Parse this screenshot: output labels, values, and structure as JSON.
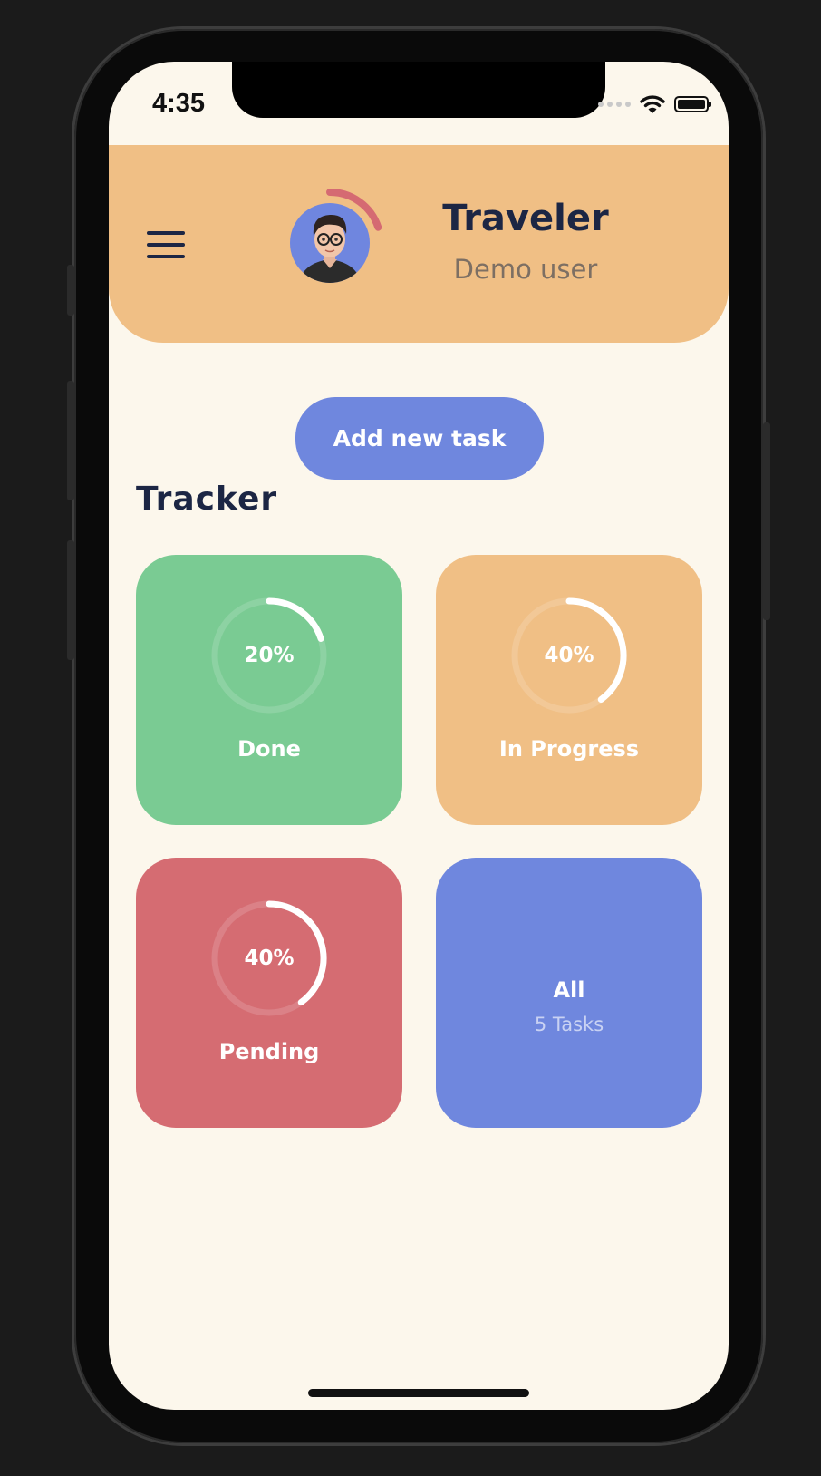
{
  "status_bar": {
    "time": "4:35"
  },
  "header": {
    "title": "Traveler",
    "subtitle": "Demo user",
    "avatar_progress": 0.2,
    "colors": {
      "background": "#f0bf85",
      "ring": "#d56a72"
    }
  },
  "actions": {
    "add_task_label": "Add new task"
  },
  "tracker": {
    "title": "Tracker",
    "cards": [
      {
        "label": "Done",
        "percent_text": "20%",
        "progress": 0.2,
        "color": "#7acb93"
      },
      {
        "label": "In Progress",
        "percent_text": "40%",
        "progress": 0.4,
        "color": "#f0bf85"
      },
      {
        "label": "Pending",
        "percent_text": "40%",
        "progress": 0.4,
        "color": "#d56c72"
      }
    ],
    "all_card": {
      "label": "All",
      "count_text": "5 Tasks",
      "color": "#6f87de"
    }
  },
  "icons": [
    "menu-icon",
    "wifi-icon",
    "battery-icon",
    "signal-icon"
  ]
}
